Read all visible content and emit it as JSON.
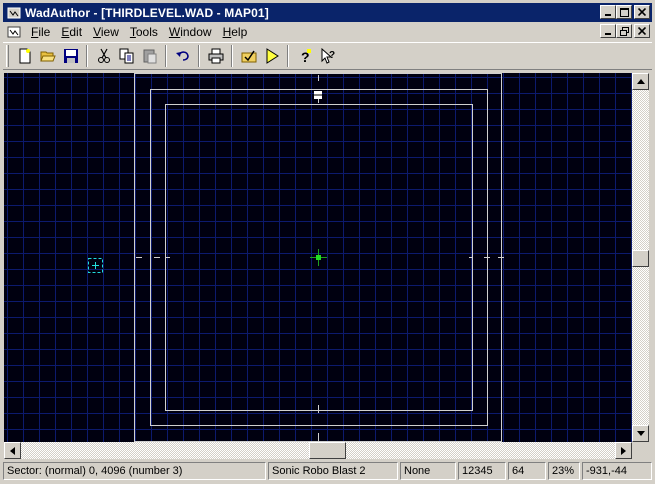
{
  "window": {
    "title": "WadAuthor - [THIRDLEVEL.WAD - MAP01]",
    "controls": {
      "minimize": "_",
      "maximize": "□",
      "close": "✕",
      "restore": "❐"
    }
  },
  "menu": [
    {
      "accel": "F",
      "rest": "ile"
    },
    {
      "accel": "E",
      "rest": "dit"
    },
    {
      "accel": "V",
      "rest": "iew"
    },
    {
      "accel": "T",
      "rest": "ools"
    },
    {
      "accel": "W",
      "rest": "indow"
    },
    {
      "accel": "H",
      "rest": "elp"
    }
  ],
  "toolbar": {
    "icons": [
      "new-file-icon",
      "open-folder-icon",
      "save-icon",
      "cut-icon",
      "copy-icon",
      "paste-icon",
      "undo-icon",
      "print-icon",
      "check-icon",
      "run-icon",
      "help-icon",
      "context-help-icon"
    ]
  },
  "map": {
    "background": "#000010",
    "grid_color": "#0c1a6e",
    "line_color": "#c8c8c8",
    "vertex_color": "#22dd22",
    "thing_color": "#22dddd"
  },
  "status": {
    "sector": "Sector: (normal) 0, 4096 (number 3)",
    "game": "Sonic Robo Blast 2",
    "mode": "None",
    "number": "12345",
    "grid": "64",
    "zoom": "23%",
    "coords": "-931,-44"
  }
}
